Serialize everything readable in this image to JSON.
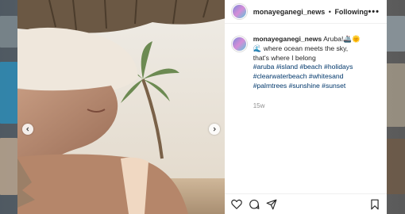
{
  "post": {
    "username": "monayeganegi_news",
    "separator": "•",
    "follow_status": "Following",
    "more_label": "•••",
    "caption": {
      "username": "monayeganegi_news",
      "text": "Aruba!🚢🌞🌊 where ocean meets the sky, that's where I belong",
      "hashtags": "#aruba #island #beach #holidays #clearwaterbeach #whitesand #palmtrees #sunshine #sunset"
    },
    "time_ago": "15w"
  },
  "icons": {
    "like": "heart-icon",
    "comment": "comment-icon",
    "share": "share-icon",
    "save": "bookmark-icon",
    "prev": "chevron-left-icon",
    "next": "chevron-right-icon"
  }
}
